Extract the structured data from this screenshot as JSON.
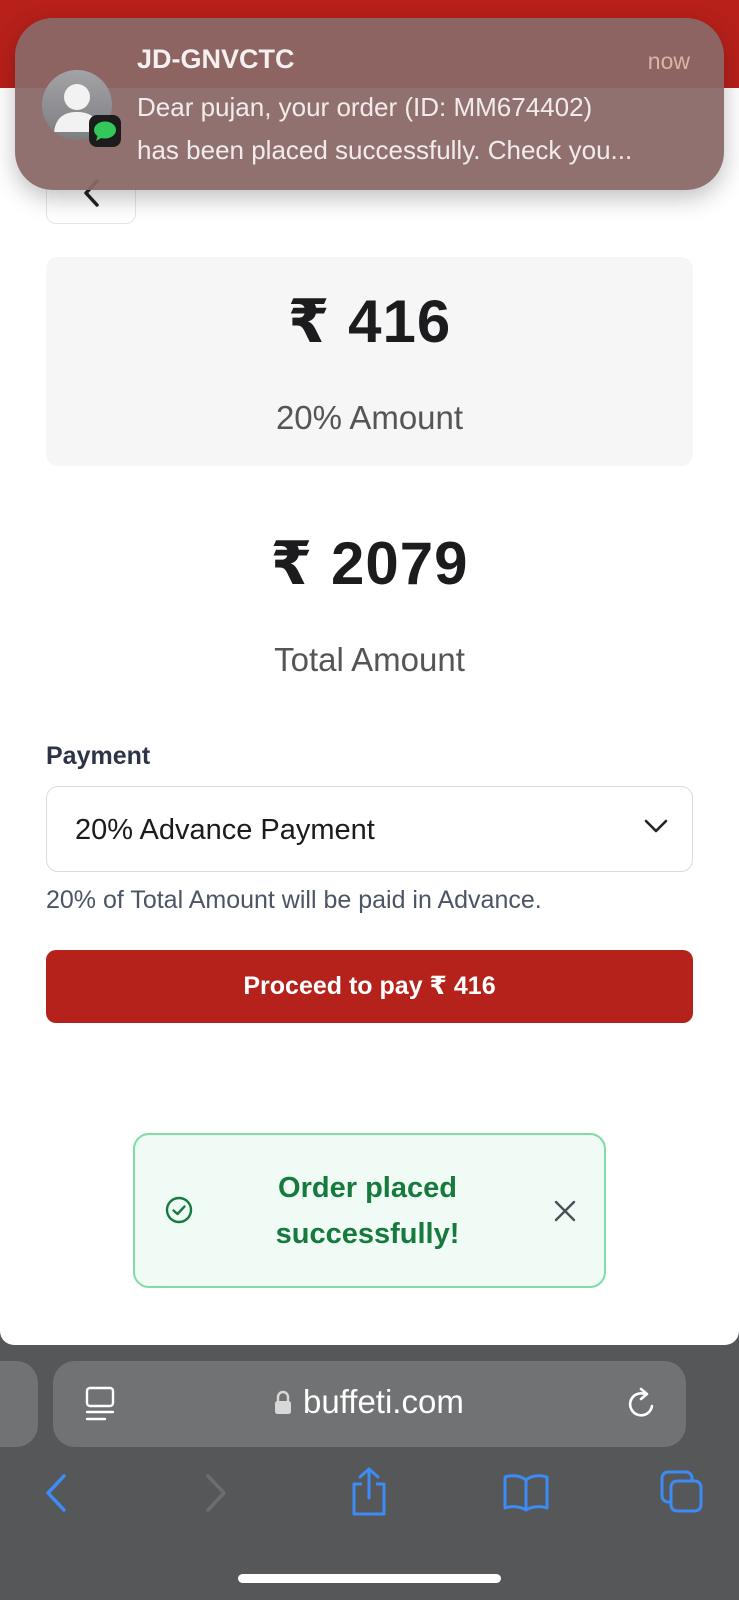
{
  "notification": {
    "sender": "JD-GNVCTC",
    "time": "now",
    "line1": "Dear pujan, your order (ID: MM674402)",
    "line2": "has been placed successfully. Check you..."
  },
  "summary": {
    "advance_amount": "₹ 416",
    "advance_label": "20% Amount",
    "total_amount": "₹ 2079",
    "total_label": "Total Amount"
  },
  "payment": {
    "label": "Payment",
    "selected": "20% Advance Payment",
    "hint": "20% of Total Amount will be paid in Advance."
  },
  "actions": {
    "proceed_label": "Proceed to pay ₹ 416"
  },
  "toast": {
    "message": "Order placed successfully!"
  },
  "browser": {
    "url": "buffeti.com"
  },
  "colors": {
    "brand_red": "#b4221b",
    "success_green": "#167a3d",
    "toast_border": "#7fdda3"
  }
}
